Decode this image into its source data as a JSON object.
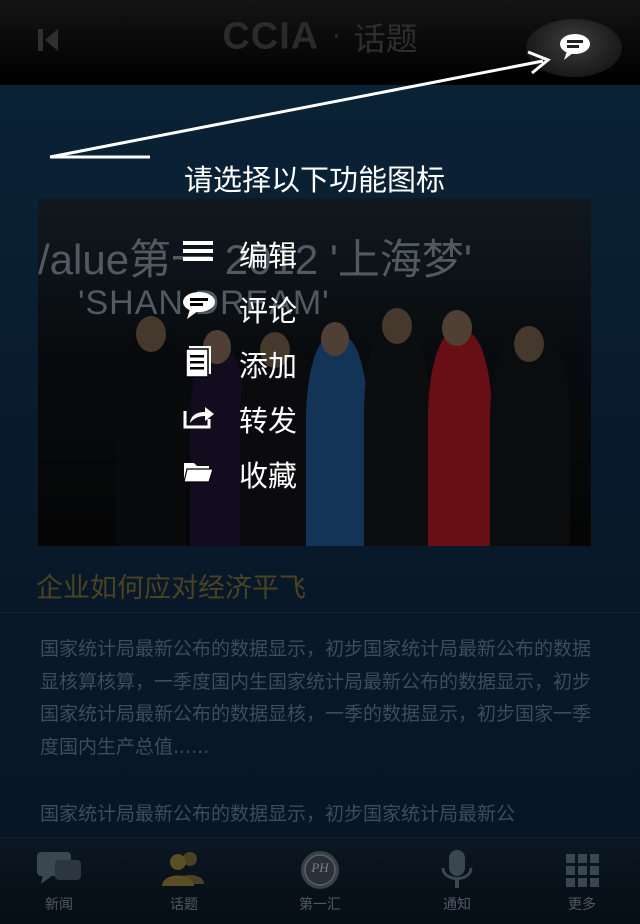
{
  "header": {
    "logo": "CCIA",
    "separator": "·",
    "title": "话题",
    "back_icon": "back-arrow-icon",
    "chat_icon": "speech-bubble-icon"
  },
  "guide": {
    "instruction": "请选择以下功能图标",
    "menu": [
      {
        "label": "编辑",
        "icon": "menu-lines-icon"
      },
      {
        "label": "评论",
        "icon": "speech-bubble-icon"
      },
      {
        "label": "添加",
        "icon": "document-icon"
      },
      {
        "label": "转发",
        "icon": "share-icon"
      },
      {
        "label": "收藏",
        "icon": "folder-icon"
      }
    ]
  },
  "article": {
    "photo_banner_line1": "/alue第一 2012 '上海梦'",
    "photo_banner_line2": "'SHAN   DREAM'",
    "title": "企业如何应对经济平飞",
    "paragraphs": [
      "国家统计局最新公布的数据显示，初步国家统计局最新公布的数据显核算核算，一季度国内生国家统计局最新公布的数据显示，初步国家统计局最新公布的数据显核，一季的数据显示，初步国家一季度国内生产总值......",
      "国家统计局最新公布的数据显示，初步国家统计局最新公"
    ]
  },
  "tabbar": {
    "tabs": [
      {
        "label": "新闻",
        "icon": "news-chat-icon"
      },
      {
        "label": "话题",
        "icon": "people-icon"
      },
      {
        "label": "第一汇",
        "icon": "logo-badge-icon"
      },
      {
        "label": "通知",
        "icon": "microphone-icon"
      },
      {
        "label": "更多",
        "icon": "grid-icon"
      }
    ],
    "badge_text": "PH"
  },
  "colors": {
    "background": "#05111b",
    "guide_text": "#ffffff",
    "article_title": "#4a4321",
    "tab_active": "#5a4e22"
  }
}
